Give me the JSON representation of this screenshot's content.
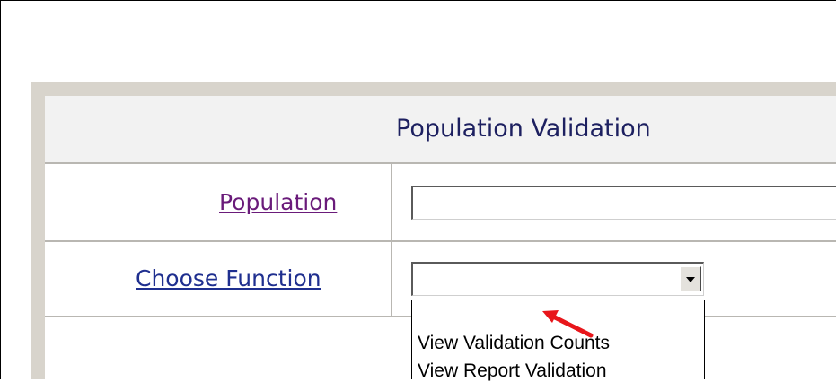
{
  "form": {
    "title": "Population Validation",
    "population_label": "Population",
    "population_value": "",
    "function_label": "Choose Function",
    "function_selected": "",
    "function_options": [
      "View Validation Counts",
      "View Report Validation"
    ]
  },
  "colors": {
    "title_text": "#1d2060",
    "visited_link": "#6a1b7a",
    "link": "#1f2f8f",
    "annotation_arrow": "#e8161b",
    "panel_bg": "#d8d4cc",
    "header_bg": "#f2f2f2"
  },
  "icons": {
    "dropdown_button": "chevron-down-icon",
    "annotation": "red-arrow-icon"
  }
}
